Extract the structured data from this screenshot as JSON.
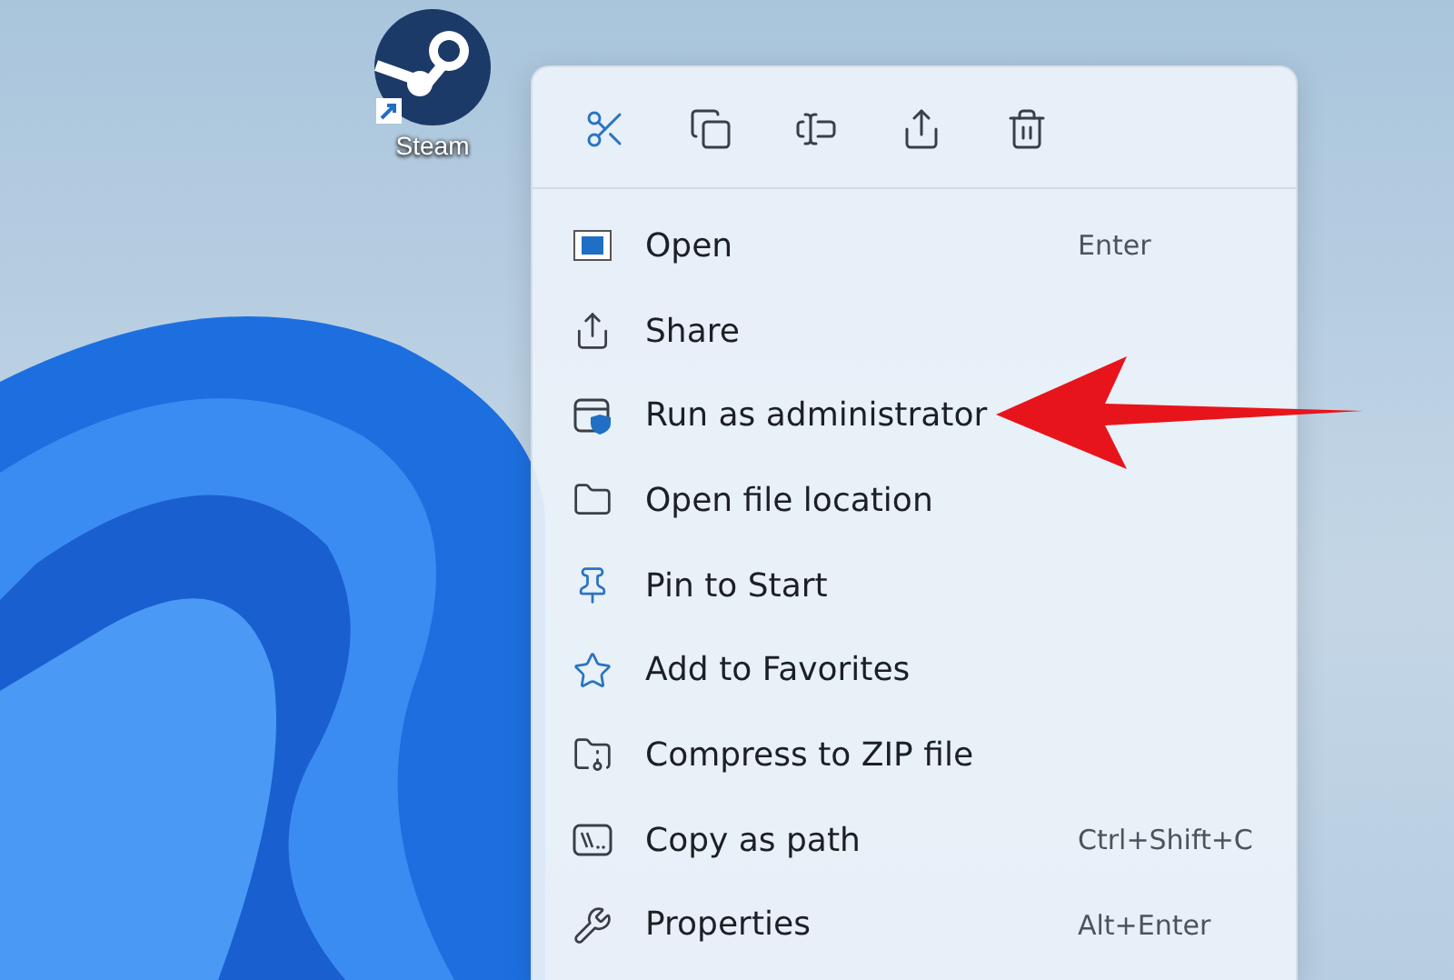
{
  "desktop_icon": {
    "label": "Steam"
  },
  "context_menu": {
    "items": [
      {
        "label": "Open",
        "shortcut": "Enter"
      },
      {
        "label": "Share"
      },
      {
        "label": "Run as administrator"
      },
      {
        "label": "Open file location"
      },
      {
        "label": "Pin to Start"
      },
      {
        "label": "Add to Favorites"
      },
      {
        "label": "Compress to ZIP file"
      },
      {
        "label": "Copy as path",
        "shortcut": "Ctrl+Shift+C"
      },
      {
        "label": "Properties",
        "shortcut": "Alt+Enter"
      }
    ]
  }
}
